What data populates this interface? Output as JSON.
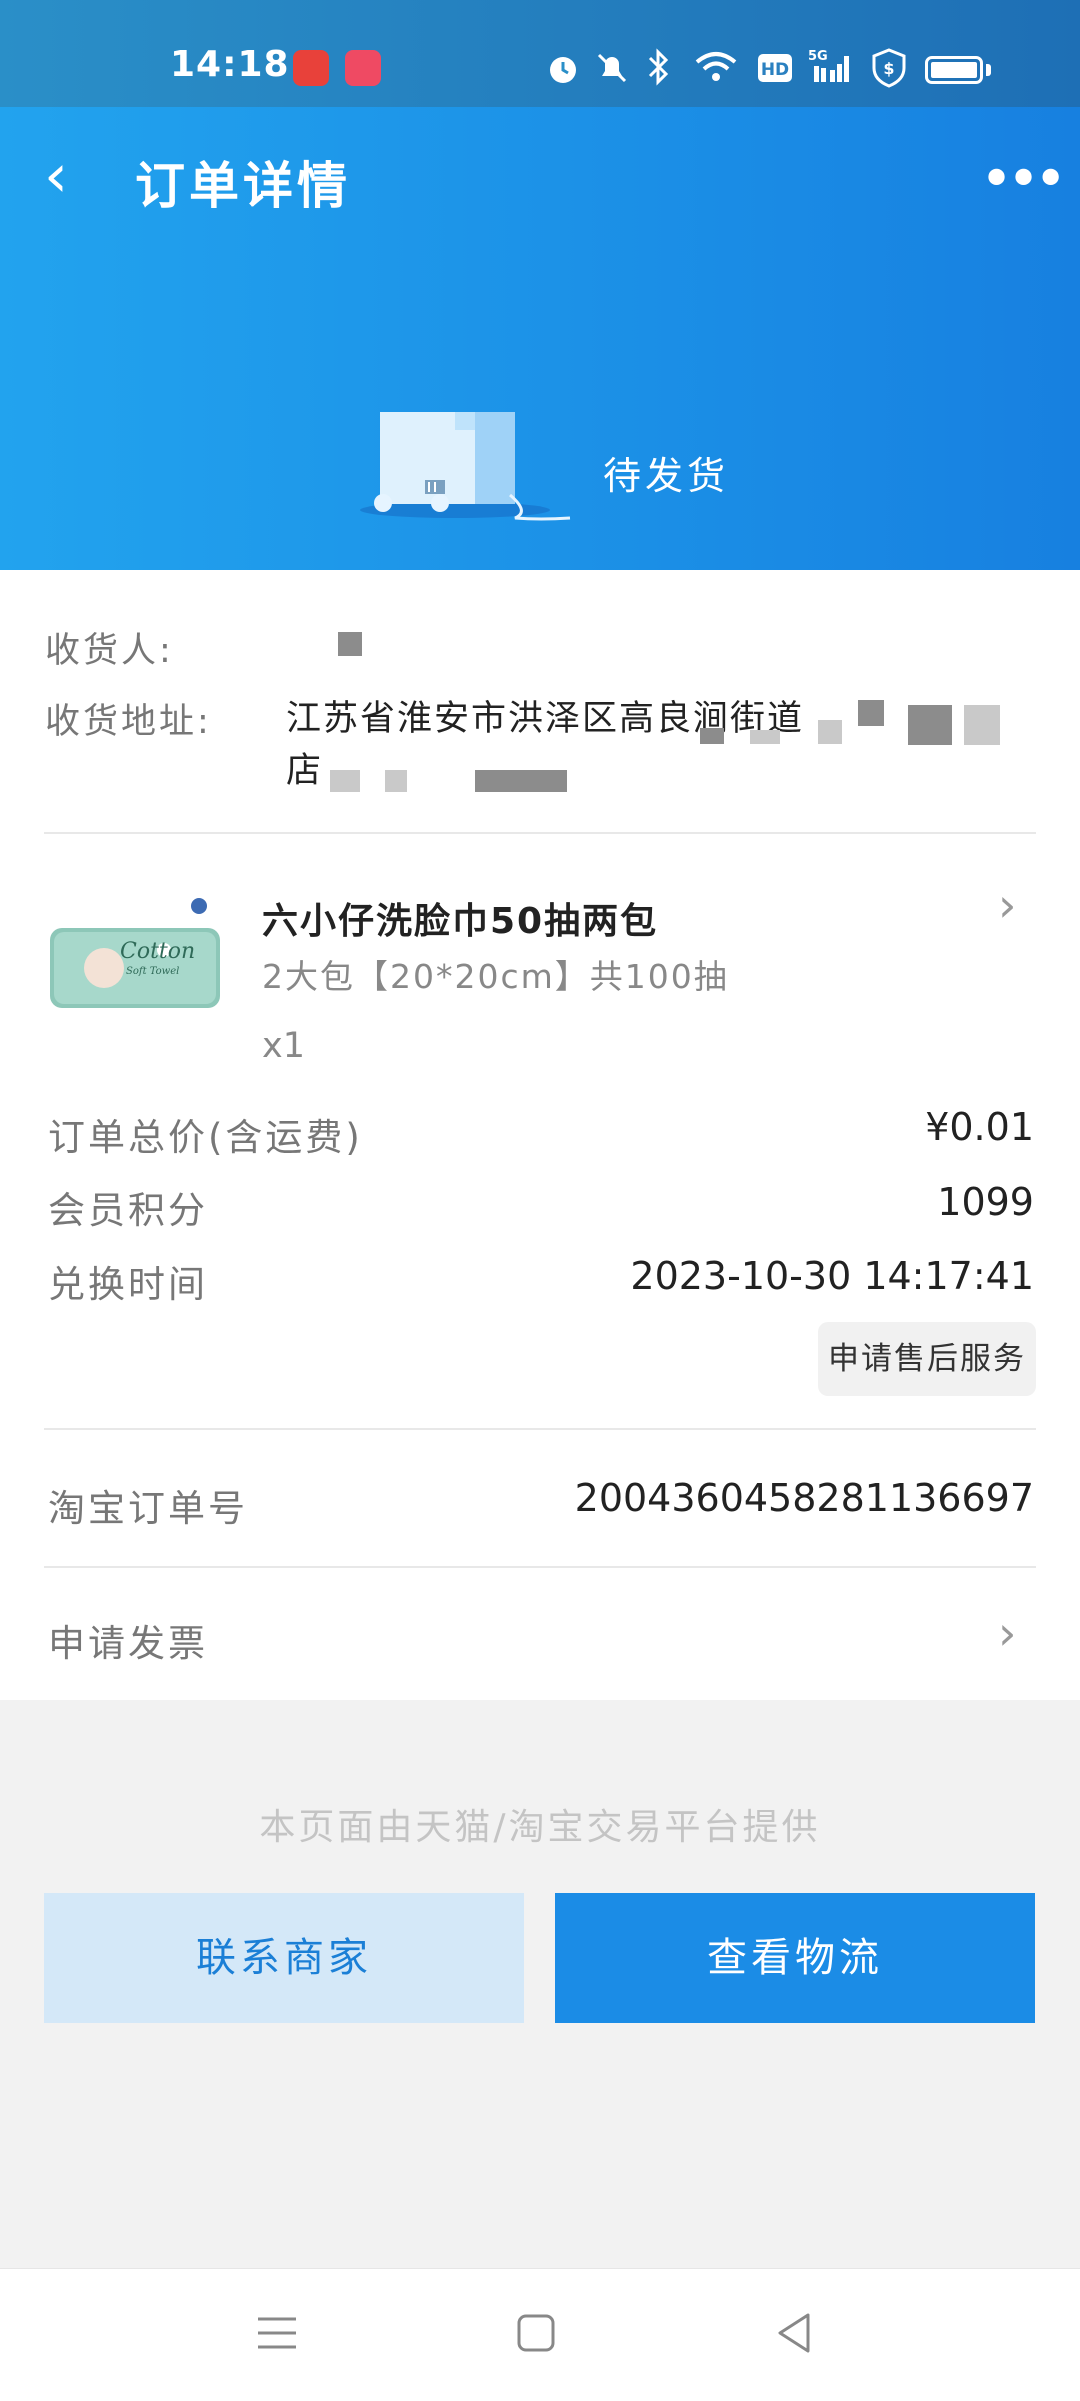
{
  "status_bar": {
    "time": "14:18",
    "icons": [
      "alarm-icon",
      "mute-icon",
      "bluetooth-icon",
      "wifi-icon",
      "hd-icon",
      "5g-signal-icon",
      "shield-icon",
      "battery-icon"
    ]
  },
  "nav": {
    "back_icon": "‹",
    "title": "订单详情",
    "more_icon": "•••"
  },
  "order_status": "待发货",
  "recipient": {
    "name_label": "收货人:",
    "address_label": "收货地址:",
    "address_line1": "江苏省淮安市洪泽区高良涧街道",
    "address_line2": "店"
  },
  "product": {
    "name": "六小仔洗脸巾50抽两包",
    "spec": "2大包【20*20cm】共100抽",
    "quantity": "x1",
    "image_text": "Cotton",
    "image_subtext": "Soft Towel"
  },
  "details": [
    {
      "label": "订单总价(含运费)",
      "value": "¥0.01"
    },
    {
      "label": "会员积分",
      "value": "1099"
    },
    {
      "label": "兑换时间",
      "value": "2023-10-30 14:17:41"
    }
  ],
  "after_sale_button": "申请售后服务",
  "taobao_order": {
    "label": "淘宝订单号",
    "value": "2004360458281136697"
  },
  "invoice": {
    "label": "申请发票"
  },
  "footer_note": "本页面由天猫/淘宝交易平台提供",
  "buttons": {
    "contact": "联系商家",
    "logistics": "查看物流"
  },
  "colors": {
    "header_blue": "#1b8fe6",
    "button_blue": "#1b8ce6",
    "light_blue": "#d4e8f8"
  }
}
